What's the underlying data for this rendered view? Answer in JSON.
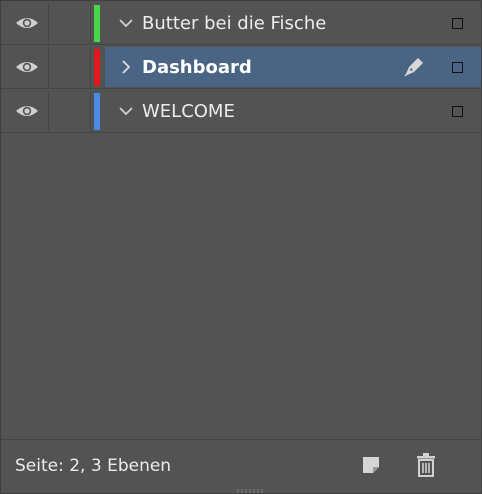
{
  "layers": [
    {
      "name": "Butter bei die Fische",
      "color": "#46d64a",
      "expanded": true,
      "selected": false,
      "bold": false
    },
    {
      "name": "Dashboard",
      "color": "#e0191d",
      "expanded": false,
      "selected": true,
      "bold": true
    },
    {
      "name": "WELCOME",
      "color": "#4a8be8",
      "expanded": true,
      "selected": false,
      "bold": false
    }
  ],
  "footer": {
    "status": "Seite: 2, 3 Ebenen"
  },
  "icons": {
    "visibility": "eye-icon",
    "active_layer": "pen-icon",
    "new_layer": "new-layer-icon",
    "delete": "trash-icon"
  },
  "colors": {
    "panel_bg": "#535353",
    "selected_bg": "#4a6484"
  }
}
